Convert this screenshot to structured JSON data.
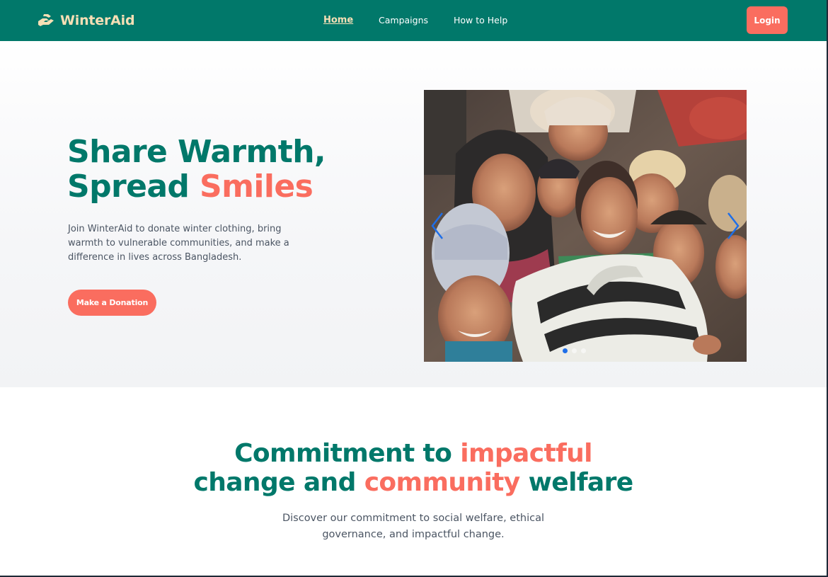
{
  "navbar": {
    "brand": "WinterAid",
    "brand_icon": "hands-helping-icon",
    "links": [
      {
        "label": "Home",
        "active": true
      },
      {
        "label": "Campaigns",
        "active": false
      },
      {
        "label": "How to Help",
        "active": false
      }
    ],
    "login_label": "Login"
  },
  "hero": {
    "title_line1": "Share Warmth,",
    "title_line2_a": "Spread ",
    "title_line2_b": "Smiles",
    "description": "Join WinterAid to donate winter clothing, bring warmth to vulnerable communities, and make a difference in lives across Bangladesh.",
    "cta_label": "Make a Donation"
  },
  "carousel": {
    "prev_icon": "chevron-left-icon",
    "next_icon": "chevron-right-icon",
    "slide_count": 3,
    "active_index": 0
  },
  "commitment": {
    "title_a": "Commitment to ",
    "title_b": "impactful",
    "title_c": "change and ",
    "title_d": "community",
    "title_e": " welfare",
    "desc_line1": "Discover our commitment to social welfare, ethical",
    "desc_line2": "governance, and impactful change."
  },
  "colors": {
    "primary": "#01786a",
    "accent": "#fa6d5f",
    "brand_text": "#f6dfb5"
  }
}
